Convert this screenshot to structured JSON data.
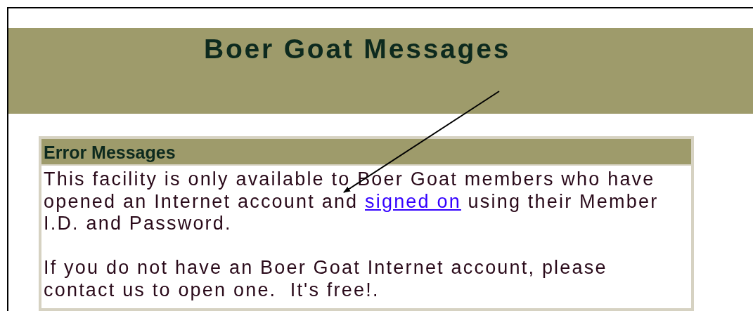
{
  "page_title": "Boer Goat Messages",
  "error_box": {
    "heading": "Error Messages",
    "paragraphs": [
      {
        "kind": "linked",
        "before": "This facility is only available to Boer Goat members who have opened an Internet account and ",
        "link": "signed on",
        "after": " using their Member I.D. and Password."
      },
      {
        "kind": "plain",
        "text": "If you do not have an Boer Goat Internet account, please contact us to open one.  It's free!."
      }
    ]
  }
}
